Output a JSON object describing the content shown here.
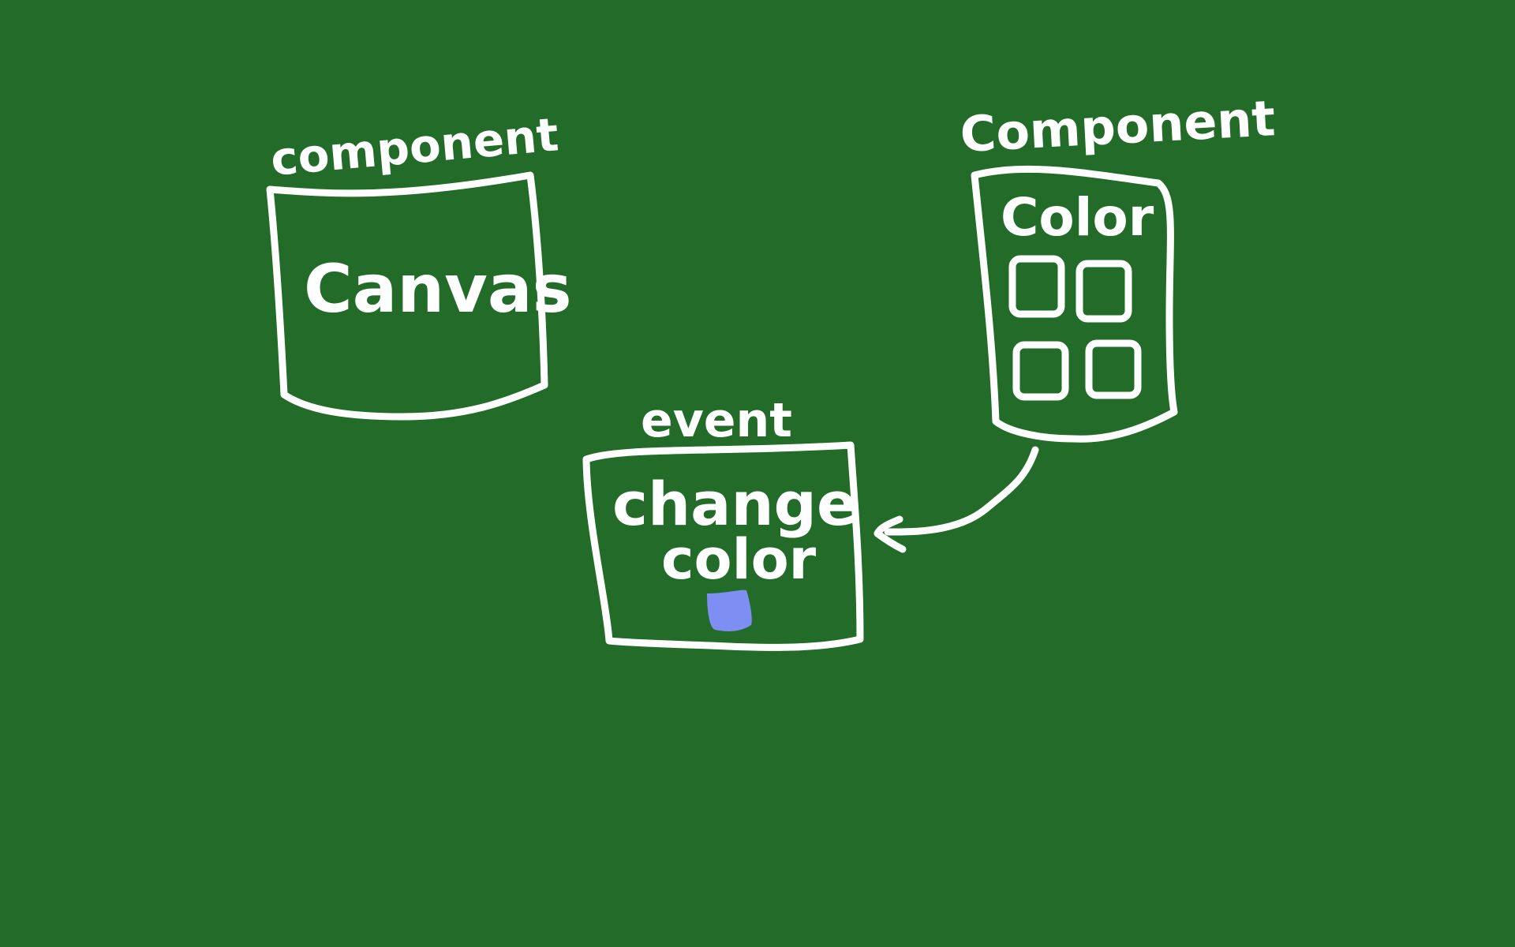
{
  "board_color": "#226b28",
  "ink_color": "#ffffff",
  "canvas_component": {
    "tag": "component",
    "label": "Canvas"
  },
  "color_component": {
    "tag": "Component",
    "label": "Color"
  },
  "change_color_event": {
    "tag": "event",
    "label_line1": "change",
    "label_line2": "color",
    "swatch_color": "#7f8ef2"
  }
}
